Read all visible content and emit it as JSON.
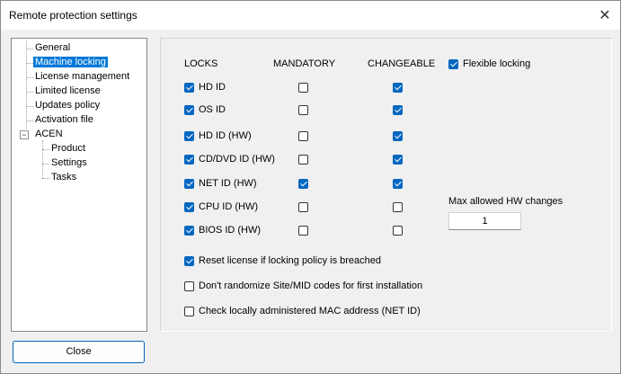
{
  "window": {
    "title": "Remote protection settings"
  },
  "tree": {
    "items": [
      {
        "label": "General",
        "selected": false
      },
      {
        "label": "Machine locking",
        "selected": true
      },
      {
        "label": "License management",
        "selected": false
      },
      {
        "label": "Limited license",
        "selected": false
      },
      {
        "label": "Updates policy",
        "selected": false
      },
      {
        "label": "Activation file",
        "selected": false
      },
      {
        "label": "ACEN",
        "selected": false,
        "expander": "−"
      },
      {
        "label": "Product",
        "selected": false
      },
      {
        "label": "Settings",
        "selected": false
      },
      {
        "label": "Tasks",
        "selected": false
      }
    ]
  },
  "headers": {
    "locks": "LOCKS",
    "mandatory": "MANDATORY",
    "changeable": "CHANGEABLE"
  },
  "flexible_locking": {
    "label": "Flexible locking",
    "checked": true
  },
  "locks": [
    {
      "label": "HD ID",
      "checked": true,
      "mandatory": false,
      "changeable": true
    },
    {
      "label": "OS ID",
      "checked": true,
      "mandatory": false,
      "changeable": true
    },
    {
      "label": "HD ID (HW)",
      "checked": true,
      "mandatory": false,
      "changeable": true
    },
    {
      "label": "CD/DVD ID (HW)",
      "checked": true,
      "mandatory": false,
      "changeable": true
    },
    {
      "label": "NET ID (HW)",
      "checked": true,
      "mandatory": true,
      "changeable": true
    },
    {
      "label": "CPU ID (HW)",
      "checked": true,
      "mandatory": false,
      "changeable": false
    },
    {
      "label": "BIOS ID (HW)",
      "checked": true,
      "mandatory": false,
      "changeable": false
    }
  ],
  "max_hw_changes": {
    "label": "Max allowed HW changes",
    "value": "1"
  },
  "options": [
    {
      "label": "Reset license if locking policy is breached",
      "checked": true
    },
    {
      "label": "Don't randomize Site/MID codes for first installation",
      "checked": false
    },
    {
      "label": "Check locally administered MAC address (NET ID)",
      "checked": false
    }
  ],
  "buttons": {
    "close_label": "Close"
  },
  "colors": {
    "accent": "#0067c0",
    "selection": "#0078d7"
  }
}
